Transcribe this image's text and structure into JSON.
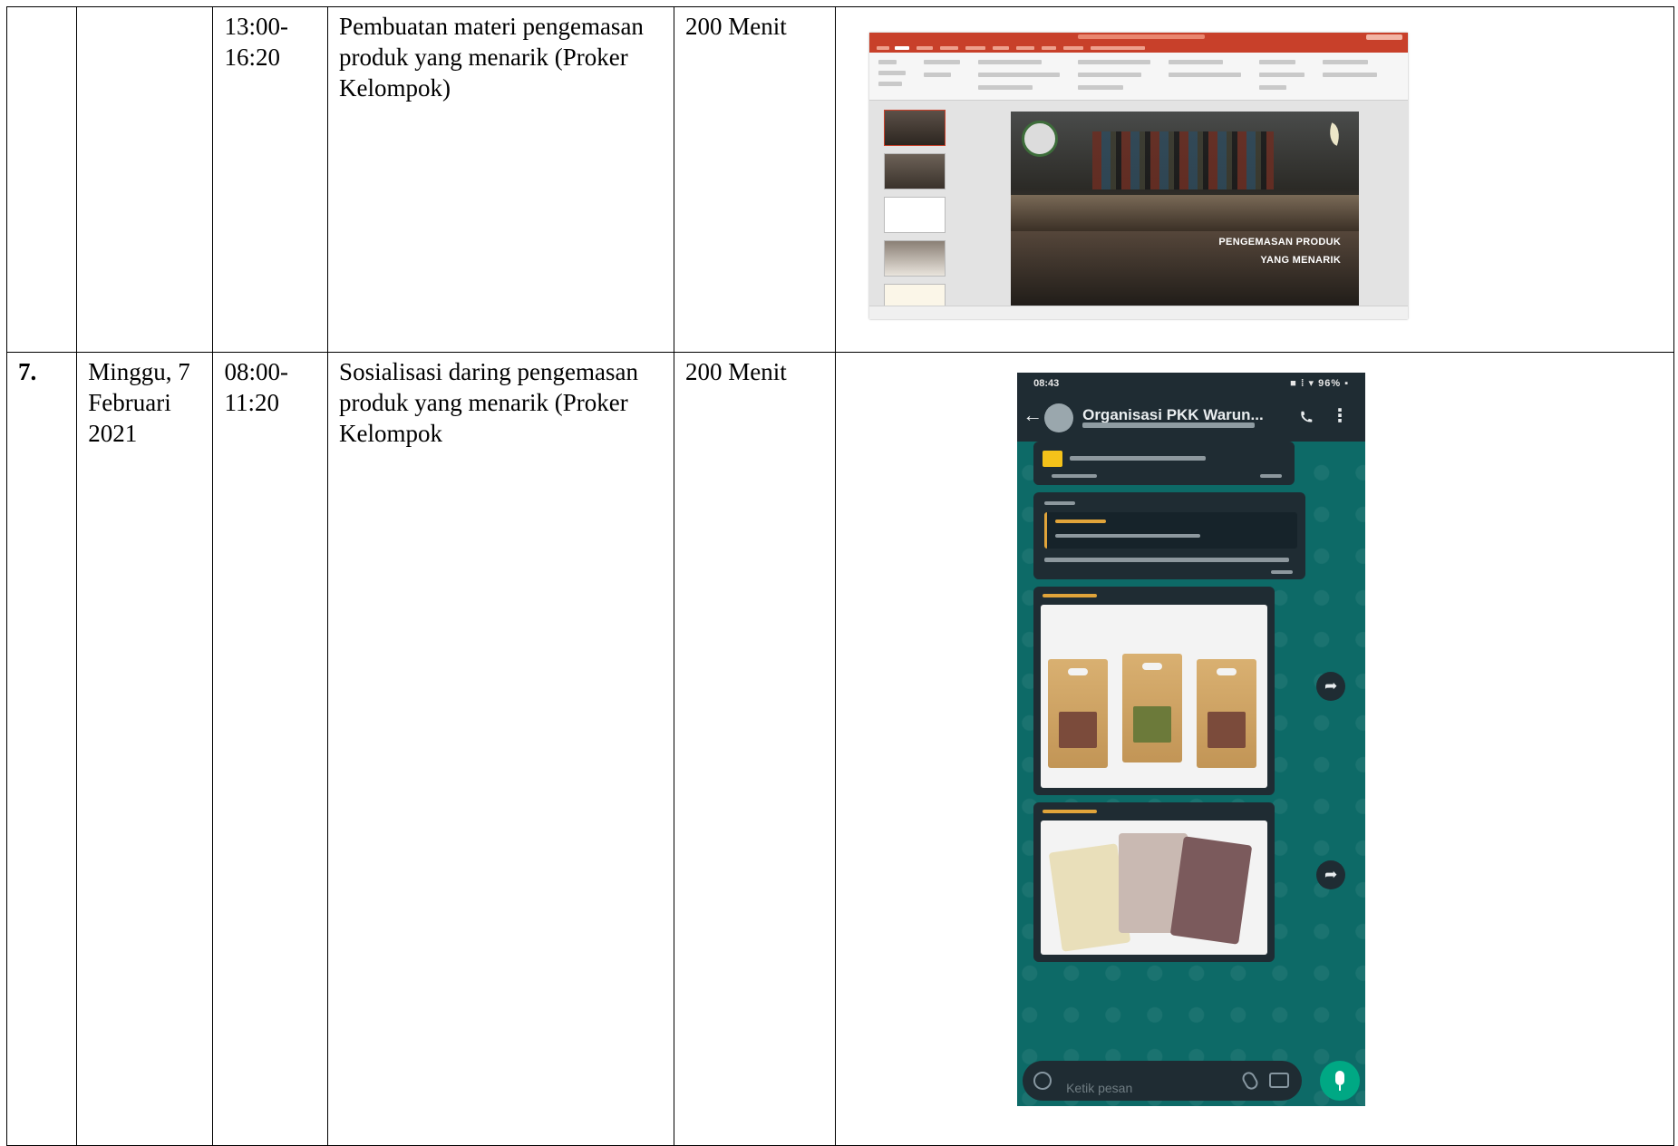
{
  "rows": [
    {
      "no": "",
      "date": "",
      "time": "13:00-\n16:20",
      "activity": "Pembuatan materi pengemasan produk yang menarik (Proker Kelompok)",
      "duration": "200 Menit",
      "documentation": {
        "kind": "powerpoint-screenshot",
        "slide_title_line1": "PENGEMASAN PRODUK",
        "slide_title_line2": "YANG MENARIK"
      }
    },
    {
      "no": "7.",
      "date": "Minggu, 7 Februari 2021",
      "time": "08:00-\n11:20",
      "activity": "Sosialisasi daring pengemasan produk yang menarik (Proker Kelompok",
      "duration": "200 Menit",
      "documentation": {
        "kind": "whatsapp-screenshot",
        "status_time": "08:43",
        "status_indicators": "■ ⁞ ▾ 96% ▪",
        "chat_name": "Organisasi PKK Warun...",
        "input_placeholder": "Ketik pesan",
        "icons": [
          "back-arrow-icon",
          "call-icon",
          "menu-icon",
          "forward-icon",
          "emoji-icon",
          "attach-icon",
          "camera-icon",
          "mic-icon"
        ]
      }
    }
  ],
  "colors": {
    "ppt_title_bar": "#c8402a",
    "wa_chat_bg": "#0d6a67",
    "wa_header": "#1f2c33",
    "wa_accent": "#00a884"
  }
}
